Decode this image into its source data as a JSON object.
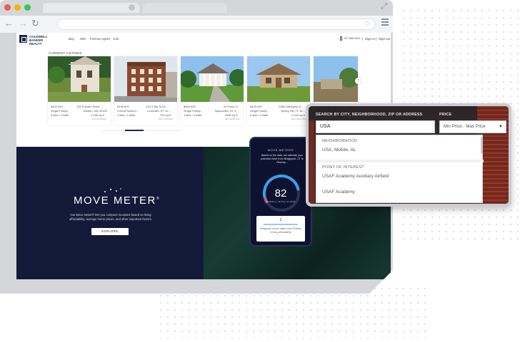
{
  "browser": {
    "traffic_colors": [
      "#f05a4f",
      "#f4b400",
      "#34c759"
    ],
    "icons": [
      "back-icon",
      "forward-icon",
      "reload-icon",
      "star-icon",
      "menu-icon",
      "expand-icon"
    ]
  },
  "site": {
    "logo_text": "COLDWELL BANKER REALTY",
    "nav": [
      "Buy",
      "Sell",
      "Find an Agent",
      "Join"
    ],
    "phone": "877-555-0100",
    "sign_in": "Sign In",
    "sign_up": "Sign Up",
    "separator": "|"
  },
  "listings": {
    "section_label": "CURRENT LISTINGS",
    "cards": [
      {
        "price": "$340,000",
        "address": "126 Putnam Stree...",
        "type": "Single Family",
        "city": "Boston, MA 02128",
        "beds": "3 Bed / 2 Bath",
        "sqft": "1,496 sq ft",
        "note": "MLS #1234567"
      },
      {
        "price": "$149,900",
        "address": "218 S 8th St #3...",
        "type": "Condo/Townho...",
        "city": "Louisville, KY 40...",
        "beds": "1 Bed / 1 Bath",
        "sqft": "720 sq ft",
        "note": "MLS #7654321"
      },
      {
        "price": "$669,900",
        "address": "20 Fawn Ct",
        "type": "Single Family",
        "city": "Taylorsville, KY 4...",
        "beds": "4 Bed / 4 Bath",
        "sqft": "4482 sq ft",
        "note": "MLS #4567123"
      },
      {
        "price": "$425,000",
        "address": "2366 Gallagher A...",
        "type": "Single Family",
        "city": "Spring Hill, FL 34...",
        "beds": "5 Bed / 2 Bath",
        "sqft": "2,100 sq ft",
        "note": "MLS #3217654"
      }
    ],
    "next_arrow": "›"
  },
  "move_meter": {
    "logo": "MOVE METER",
    "trademark": "®",
    "description": "Our Move Meter® lets you compare locations based on living affordability, average home prices, and other important factors.",
    "explore_label": "EXPLORE",
    "phone_title": "MOVE METER®",
    "phone_text": "Based on the data, we estimate your potential move from Bridgeport, CT to Pinellas...",
    "score": "82",
    "score_label": "OVERALL MOVE SCORE",
    "score_fraction": 0.82,
    "card_symbol": "$",
    "card_text": "Bridgeport scores higher than Pinellas in living affordability.",
    "gauge_color": "#3aa0e8",
    "gauge_accent": "#e0457b"
  },
  "search_popup": {
    "location_label": "SEARCH BY CITY, NEIGHBORHOOD, ZIP OR ADDRESS",
    "price_label": "PRICE",
    "query": "USA",
    "price_value": "Min Price - Max Price",
    "groups": [
      {
        "heading": "NEIGHBORHOOD",
        "items": [
          "USA, Mobile, AL"
        ]
      },
      {
        "heading": "POINT OF INTEREST",
        "items": [
          "USAF Academy Auxiliary Airfield",
          "USAF Academy"
        ]
      }
    ]
  }
}
